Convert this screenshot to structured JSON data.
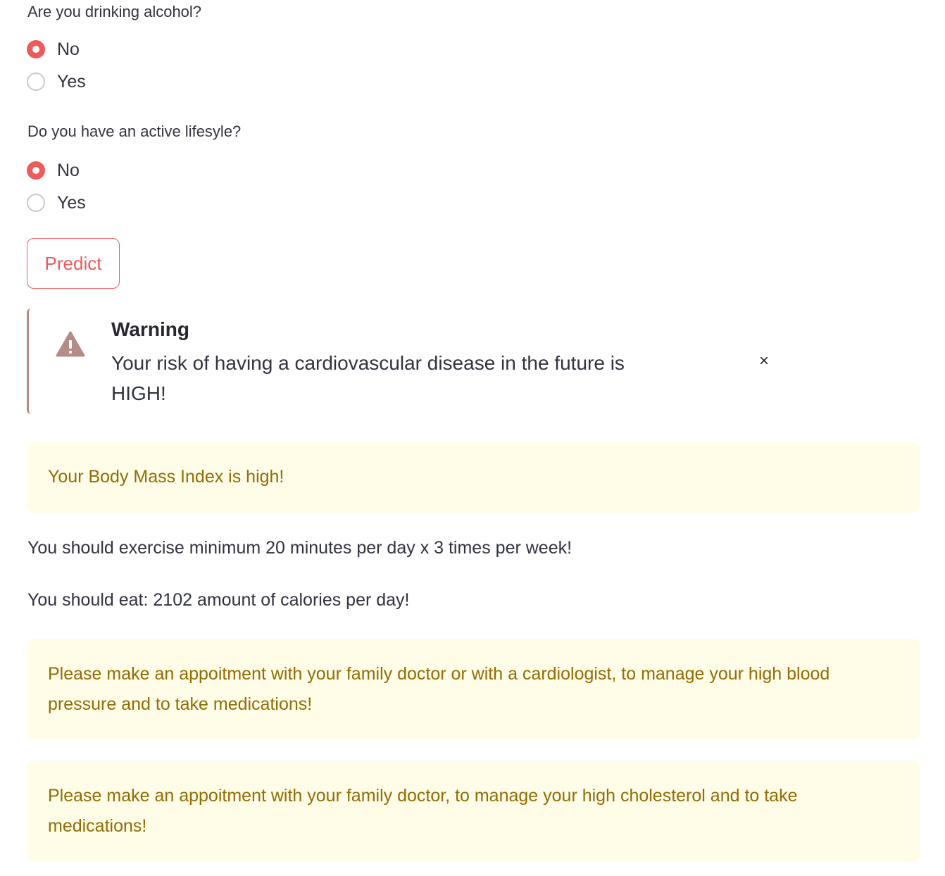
{
  "alcohol": {
    "question": "Are you drinking alcohol?",
    "options": [
      "No",
      "Yes"
    ],
    "selected": "No"
  },
  "lifestyle": {
    "question": "Do you have an active lifesyle?",
    "options": [
      "No",
      "Yes"
    ],
    "selected": "No"
  },
  "predict_button": {
    "label": "Predict"
  },
  "warning": {
    "icon": "warning-triangle-icon",
    "title": "Warning",
    "message": "Your risk of having a cardiovascular disease in the future is HIGH!",
    "close_label": "×"
  },
  "bmi_notice": "Your Body Mass Index is high!",
  "exercise_text": "You should exercise minimum 20 minutes per day x 3 times per week!",
  "calories_text": "You should eat: 2102 amount of calories per day!",
  "blood_pressure_notice": "Please make an appoitment with your family doctor or with a cardiologist, to manage your high blood pressure and to take medications!",
  "cholesterol_notice": "Please make an appoitment with your family doctor, to manage your high cholesterol and to take medications!",
  "colors": {
    "accent": "#ef5a5a",
    "warning_border": "#b58b86",
    "notice_bg": "#fffce7",
    "notice_text": "#926c05",
    "body_text": "#31333f"
  }
}
